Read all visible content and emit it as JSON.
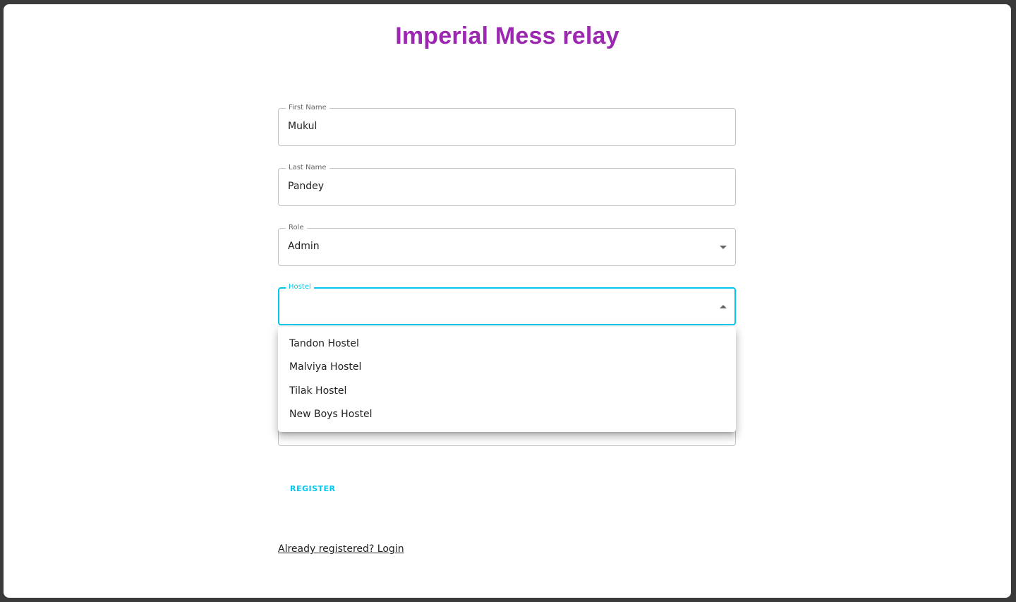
{
  "app": {
    "title": "Imperial Mess relay"
  },
  "form": {
    "first_name": {
      "label": "First Name",
      "value": "Mukul"
    },
    "last_name": {
      "label": "Last Name",
      "value": "Pandey"
    },
    "role": {
      "label": "Role",
      "value": "Admin"
    },
    "hostel": {
      "label": "Hostel",
      "value": ""
    }
  },
  "hostel_menu": {
    "options": [
      "Tandon Hostel",
      "Malviya Hostel",
      "Tilak Hostel",
      "New Boys Hostel"
    ]
  },
  "actions": {
    "register_label": "REGISTER",
    "login_link_label": "Already registered? Login"
  },
  "colors": {
    "title": "#9c27b0",
    "accent": "#00c8f0"
  }
}
